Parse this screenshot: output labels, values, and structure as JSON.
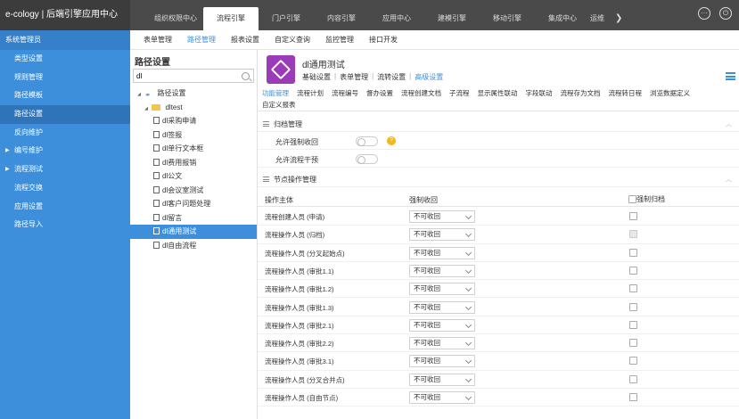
{
  "app": {
    "brand": "e-cology | 后端引擎应用中心"
  },
  "topnav": {
    "tabs": [
      "组织权限中心",
      "流程引擎",
      "门户引擎",
      "内容引擎",
      "应用中心",
      "建模引擎",
      "移动引擎",
      "集成中心",
      "运维"
    ],
    "active": "流程引擎",
    "more_arrow": "❯"
  },
  "sidebar": {
    "header": "系统管理员",
    "items": [
      {
        "label": "类型设置",
        "active": false,
        "expandable": false
      },
      {
        "label": "规则管理",
        "active": false,
        "expandable": false
      },
      {
        "label": "路径模板",
        "active": false,
        "expandable": false
      },
      {
        "label": "路径设置",
        "active": true,
        "expandable": false
      },
      {
        "label": "反向维护",
        "active": false,
        "expandable": false
      },
      {
        "label": "编号维护",
        "active": false,
        "expandable": true
      },
      {
        "label": "流程测试",
        "active": false,
        "expandable": true
      },
      {
        "label": "流程交换",
        "active": false,
        "expandable": false
      },
      {
        "label": "应用设置",
        "active": false,
        "expandable": false
      },
      {
        "label": "路径导入",
        "active": false,
        "expandable": false
      }
    ]
  },
  "subnav": {
    "items": [
      "表单管理",
      "路径管理",
      "报表设置",
      "自定义查询",
      "监控管理",
      "接口开发"
    ],
    "active": "路径管理"
  },
  "tree": {
    "title": "路径设置",
    "search_value": "dl",
    "root": "路径设置",
    "folder": "dltest",
    "nodes": [
      "dl采购申请",
      "dl签报",
      "dl单行文本框",
      "dl费用报销",
      "dl公文",
      "dl会议室测试",
      "dl客户问题处理",
      "dl留言",
      "dl通用测试",
      "dl自由流程"
    ],
    "selected": "dl通用测试"
  },
  "workflow": {
    "title": "dl通用测试",
    "tabs": [
      "基础设置",
      "表单管理",
      "流转设置",
      "高级设置"
    ],
    "active_tab": "高级设置"
  },
  "func_tabs": {
    "row1": [
      "功能管理",
      "流程计划",
      "流程编号",
      "督办设置",
      "流程创建文档",
      "子流程",
      "显示属性联动",
      "字段联动",
      "流程存为文档",
      "流程转日程",
      "浏览数据定义"
    ],
    "row2": [
      "自定义报表"
    ],
    "active": "功能管理"
  },
  "archive_section": {
    "title": "归档管理",
    "rows": [
      {
        "label": "允许强制收回",
        "help": "?"
      },
      {
        "label": "允许流程干预"
      }
    ]
  },
  "node_section": {
    "title": "节点操作管理",
    "columns": [
      "操作主体",
      "强制收回",
      "强制归档"
    ],
    "rows": [
      {
        "subject": "流程创建人员 (申请)",
        "recall": "不可收回",
        "archive_disabled": false
      },
      {
        "subject": "流程操作人员 (归档)",
        "recall": "不可收回",
        "archive_disabled": true
      },
      {
        "subject": "流程操作人员 (分叉起始点)",
        "recall": "不可收回",
        "archive_disabled": false
      },
      {
        "subject": "流程操作人员 (审批1.1)",
        "recall": "不可收回",
        "archive_disabled": false
      },
      {
        "subject": "流程操作人员 (审批1.2)",
        "recall": "不可收回",
        "archive_disabled": false
      },
      {
        "subject": "流程操作人员 (审批1.3)",
        "recall": "不可收回",
        "archive_disabled": false
      },
      {
        "subject": "流程操作人员 (审批2.1)",
        "recall": "不可收回",
        "archive_disabled": false
      },
      {
        "subject": "流程操作人员 (审批2.2)",
        "recall": "不可收回",
        "archive_disabled": false
      },
      {
        "subject": "流程操作人员 (审批3.1)",
        "recall": "不可收回",
        "archive_disabled": false
      },
      {
        "subject": "流程操作人员 (分叉合并点)",
        "recall": "不可收回",
        "archive_disabled": false
      },
      {
        "subject": "流程操作人员 (自由节点)",
        "recall": "不可收回",
        "archive_disabled": false
      }
    ]
  },
  "colors": {
    "accent": "#3d8fdc",
    "topbar": "#4a4a4a",
    "sidebar": "#3d8fdc",
    "icon_purple": "#9c3bb8",
    "help": "#f3b818"
  }
}
